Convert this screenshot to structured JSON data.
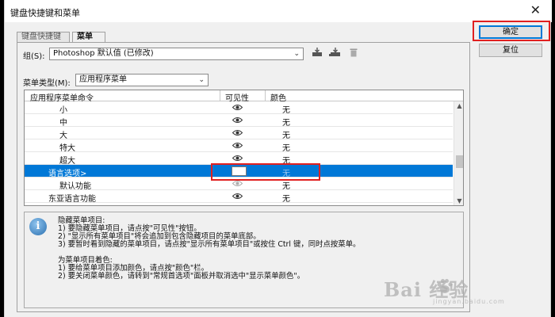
{
  "dialog": {
    "title": "键盘快捷键和菜单",
    "close_glyph": "✕",
    "buttons": {
      "ok": "确定",
      "reset": "复位"
    }
  },
  "tabs": [
    {
      "label": "键盘快捷键",
      "active": false
    },
    {
      "label": "菜单",
      "active": true
    }
  ],
  "set": {
    "label": "组(S):",
    "value": "Photoshop 默认值 (已修改)"
  },
  "menu_type": {
    "label": "菜单类型(M):",
    "value": "应用程序菜单"
  },
  "icons": {
    "save_set": "save-set-icon",
    "new_set": "new-set-icon",
    "delete_set": "trash-icon",
    "visibility": "eye-icon",
    "info": "info-icon"
  },
  "table": {
    "headers": {
      "command": "应用程序菜单命令",
      "visibility": "可见性",
      "color": "颜色"
    },
    "rows": [
      {
        "command": "小",
        "visible": true,
        "color": "无",
        "selected": false
      },
      {
        "command": "中",
        "visible": true,
        "color": "无",
        "selected": false
      },
      {
        "command": "大",
        "visible": true,
        "color": "无",
        "selected": false
      },
      {
        "command": "特大",
        "visible": true,
        "color": "无",
        "selected": false
      },
      {
        "command": "超大",
        "visible": true,
        "color": "无",
        "selected": false
      },
      {
        "command": "语言选项>",
        "visible": false,
        "color": "无",
        "selected": true
      },
      {
        "command": "默认功能",
        "visible": true,
        "color": "无",
        "selected": false
      },
      {
        "command": "东亚语言功能",
        "visible": true,
        "color": "无",
        "selected": false
      }
    ]
  },
  "info": {
    "lines": [
      "隐藏菜单项目:",
      "1) 要隐藏菜单项目，请点按\"可见性\"按钮。",
      "2) \"显示所有菜单项目\"将会追加到包含隐藏项目的菜单底部。",
      "3) 要暂时看到隐藏的菜单项目，请点按\"显示所有菜单项目\"或按住 Ctrl 键，同时点按菜单。",
      "为菜单项目着色:",
      "1) 要给菜单项目添加颜色，请点按\"颜色\"栏。",
      "2) 要关闭菜单颜色，请转到\"常规首选项\"面板并取消选中\"显示菜单颜色\"。"
    ]
  },
  "watermark": {
    "text": "Bai 经验",
    "sub": "jingyan.baidu.com"
  },
  "colors": {
    "selection": "#0078d7",
    "annotation": "#e02020"
  }
}
